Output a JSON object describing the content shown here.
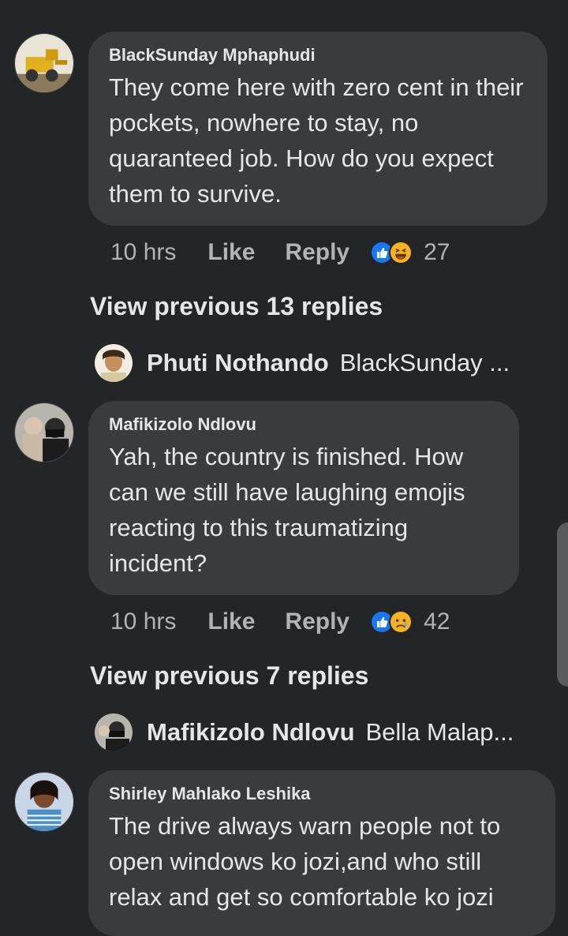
{
  "comments": [
    {
      "author": "BlackSunday Mphaphudi",
      "text": "They come here with zero cent in their pockets, nowhere to stay, no quaranteed job. How do you expect them to survive.",
      "time": "10 hrs",
      "like_label": "Like",
      "reply_label": "Reply",
      "reaction_icons": [
        "like-icon",
        "laugh-icon"
      ],
      "reaction_count": "27",
      "view_previous": "View previous 13 replies",
      "latest_reply": {
        "author": "Phuti Nothando",
        "preview": "BlackSunday ..."
      }
    },
    {
      "author": "Mafikizolo Ndlovu",
      "text": "Yah, the country is finished. How can we still have laughing emojis reacting to this traumatizing incident?",
      "time": "10 hrs",
      "like_label": "Like",
      "reply_label": "Reply",
      "reaction_icons": [
        "like-icon",
        "sad-icon"
      ],
      "reaction_count": "42",
      "view_previous": "View previous 7 replies",
      "latest_reply": {
        "author": "Mafikizolo Ndlovu",
        "preview": "Bella Malap..."
      }
    },
    {
      "author": "Shirley Mahlako Leshika",
      "text": "The drive always warn people not to open windows ko jozi,and who still relax and get so comfortable ko jozi"
    }
  ],
  "colors": {
    "background": "#242526",
    "bubble": "#3a3b3c",
    "primary_text": "#e4e6eb",
    "secondary_text": "#b0b3b8",
    "like_blue": "#1877f2",
    "emoji_yellow": "#f7b125"
  }
}
